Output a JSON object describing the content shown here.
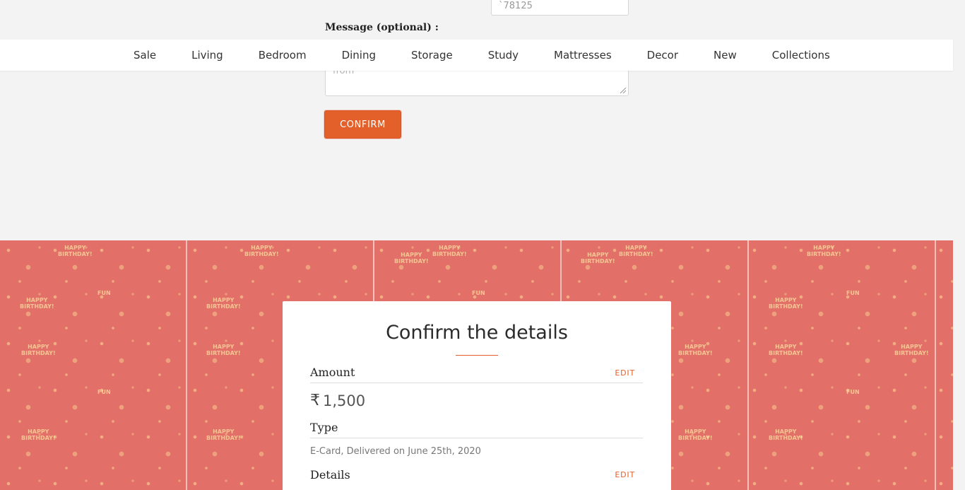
{
  "form": {
    "zip_value": "`78125",
    "message_label": "Message (optional) :",
    "message_placeholder": "from",
    "confirm_label": "CONFIRM"
  },
  "nav": {
    "items": [
      "Sale",
      "Living",
      "Bedroom",
      "Dining",
      "Storage",
      "Study",
      "Mattresses",
      "Decor",
      "New",
      "Collections"
    ]
  },
  "background": {
    "pattern_texts": [
      "HAPPY BIRTHDAY!",
      "FUN"
    ]
  },
  "card": {
    "title": "Confirm the details",
    "amount": {
      "label": "Amount",
      "edit_label": "EDIT",
      "currency_symbol": "₹",
      "value": "1,500"
    },
    "type": {
      "label": "Type",
      "value": "E-Card, Delivered on June 25th, 2020"
    },
    "details": {
      "label": "Details",
      "edit_label": "EDIT"
    }
  },
  "colors": {
    "accent": "#e4602a",
    "pattern_bg": "#e27068",
    "page_bg": "#f3f3f3"
  }
}
